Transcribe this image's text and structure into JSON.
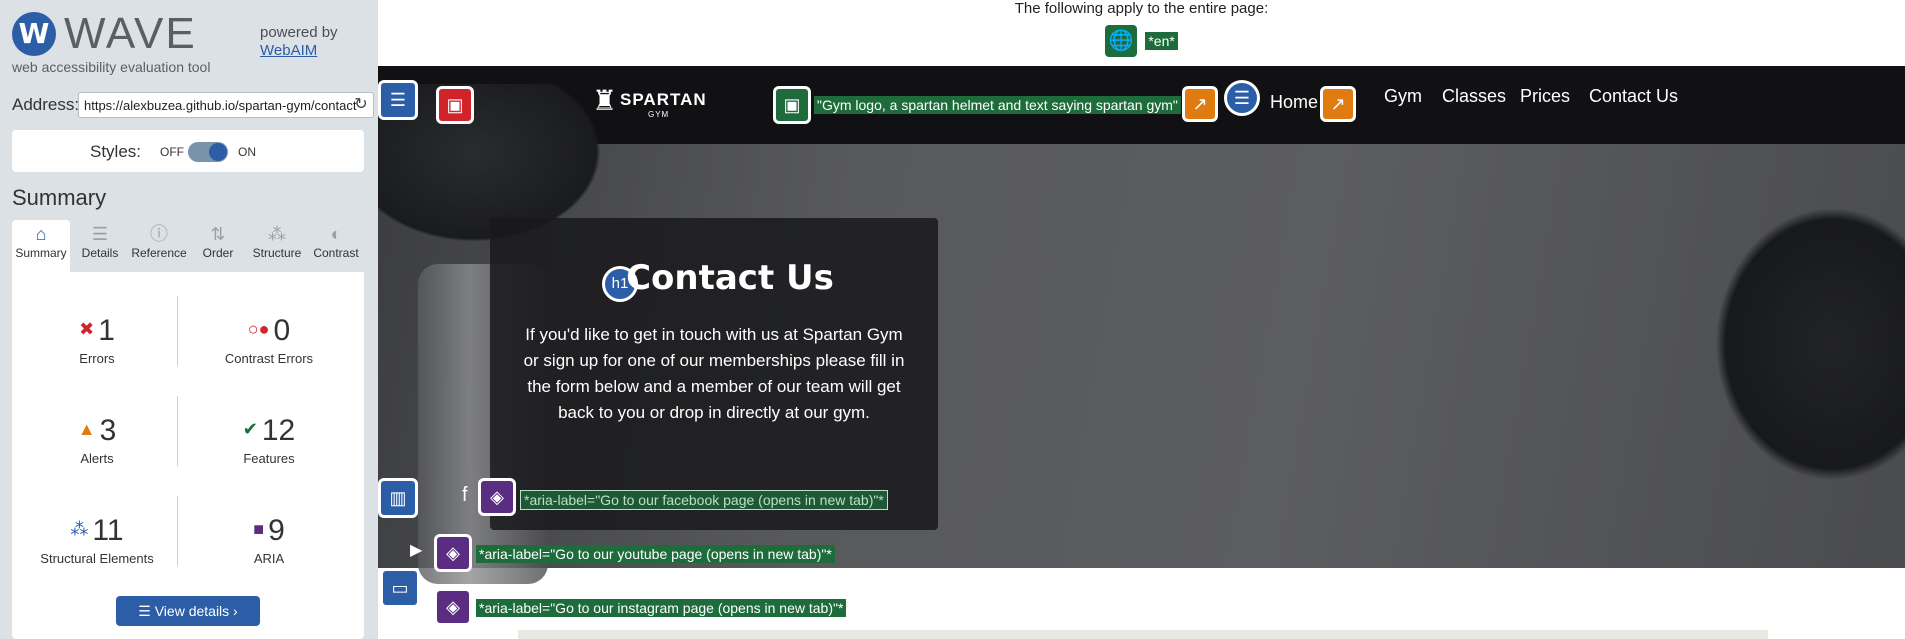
{
  "wave": {
    "logo_mark": "W",
    "logo_text": "WAVE",
    "tagline": "web accessibility evaluation tool",
    "powered_by": "powered by",
    "powered_link": "WebAIM",
    "address_label": "Address:",
    "address_value": "https://alexbuzea.github.io/spartan-gym/contact",
    "styles_label": "Styles:",
    "styles_off": "OFF",
    "styles_on": "ON",
    "summary_title": "Summary",
    "tabs": [
      {
        "label": "Summary",
        "icon": "home-icon",
        "glyph": "⌂"
      },
      {
        "label": "Details",
        "icon": "list-icon",
        "glyph": "☰"
      },
      {
        "label": "Reference",
        "icon": "info-icon",
        "glyph": "ⓘ"
      },
      {
        "label": "Order",
        "icon": "order-icon",
        "glyph": "⇅"
      },
      {
        "label": "Structure",
        "icon": "structure-icon",
        "glyph": "⁂"
      },
      {
        "label": "Contrast",
        "icon": "contrast-icon",
        "glyph": "◐"
      }
    ],
    "stats": {
      "errors": {
        "count": "1",
        "label": "Errors"
      },
      "contrast": {
        "count": "0",
        "label": "Contrast Errors"
      },
      "alerts": {
        "count": "3",
        "label": "Alerts"
      },
      "features": {
        "count": "12",
        "label": "Features"
      },
      "structural": {
        "count": "11",
        "label": "Structural Elements"
      },
      "aria": {
        "count": "9",
        "label": "ARIA"
      }
    },
    "view_details": "View details ›"
  },
  "page": {
    "note": "The following apply to the entire page:",
    "lang_tag": "*en*",
    "logo_alt": "\"Gym logo, a spartan helmet and text saying spartan gym\"",
    "logo_text": "SPARTAN",
    "logo_sub": "GYM",
    "nav": [
      "Home",
      "Gym",
      "Classes",
      "Prices",
      "Contact Us"
    ],
    "heading": "Contact Us",
    "heading_badge": "h1",
    "intro": "If you'd like to get in touch with us at Spartan Gym or sign up for one of our memberships please fill in the form below and a member of our team will get back to you or drop in directly at our gym.",
    "aria_facebook": "*aria-label=\"Go to our facebook page (opens in new tab)\"*",
    "aria_youtube": "*aria-label=\"Go to our youtube page (opens in new tab)\"*",
    "aria_instagram": "*aria-label=\"Go to our instagram page (opens in new tab)\"*"
  },
  "colors": {
    "wave_blue": "#2c5ea8",
    "error_red": "#d0242a",
    "feature_green": "#1e6b3b",
    "alert_orange": "#e07b12",
    "aria_purple": "#5a2d82",
    "navbar": "#111114"
  }
}
